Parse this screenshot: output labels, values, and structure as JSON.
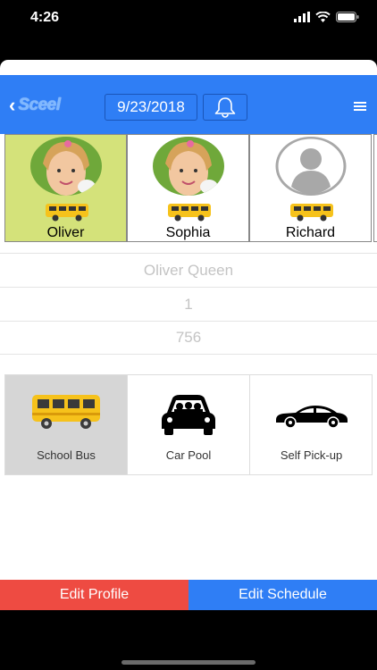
{
  "status_bar": {
    "time": "4:26",
    "icons": [
      "signal-icon",
      "wifi-icon",
      "battery-icon"
    ]
  },
  "navbar": {
    "logo": "Sceel",
    "date": "9/23/2018",
    "icons": [
      "back-chevron-icon",
      "bell-icon",
      "menu-icon"
    ]
  },
  "kids": [
    {
      "name": "Oliver",
      "selected": true,
      "photo": "child-photo"
    },
    {
      "name": "Sophia",
      "selected": false,
      "photo": "child-photo"
    },
    {
      "name": "Richard",
      "selected": false,
      "photo": "default-avatar"
    }
  ],
  "student": {
    "name": "Oliver Queen",
    "field2": "1",
    "field3": "756"
  },
  "transport_modes": [
    {
      "label": "School Bus",
      "icon": "school-bus-icon",
      "selected": true
    },
    {
      "label": "Car Pool",
      "icon": "car-pool-icon",
      "selected": false
    },
    {
      "label": "Self Pick-up",
      "icon": "car-icon",
      "selected": false
    }
  ],
  "actions": {
    "edit_profile": "Edit Profile",
    "edit_schedule": "Edit Schedule"
  },
  "colors": {
    "nav_blue": "#2f7ef5",
    "selected_kid": "#d4e27a",
    "edit_profile": "#ee4b42",
    "selected_mode": "#d6d6d6"
  }
}
